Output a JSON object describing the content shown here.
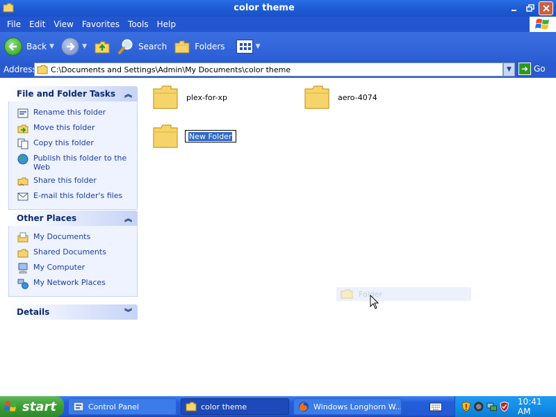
{
  "window": {
    "title": "color theme"
  },
  "menu": {
    "items": [
      "File",
      "Edit",
      "View",
      "Favorites",
      "Tools",
      "Help"
    ]
  },
  "toolbar": {
    "back_label": "Back",
    "search_label": "Search",
    "folders_label": "Folders"
  },
  "address": {
    "label": "Address",
    "path": "C:\\Documents and Settings\\Admin\\My Documents\\color theme",
    "go_label": "Go"
  },
  "tasks": {
    "title": "File and Folder Tasks",
    "items": [
      {
        "label": "Rename this folder",
        "icon": "rename-icon"
      },
      {
        "label": "Move this folder",
        "icon": "move-icon"
      },
      {
        "label": "Copy this folder",
        "icon": "copy-icon"
      },
      {
        "label": "Publish this folder to the Web",
        "icon": "globe-icon"
      },
      {
        "label": "Share this folder",
        "icon": "share-icon"
      },
      {
        "label": "E-mail this folder's files",
        "icon": "email-icon"
      }
    ]
  },
  "other_places": {
    "title": "Other Places",
    "items": [
      {
        "label": "My Documents",
        "icon": "my-documents-icon"
      },
      {
        "label": "Shared Documents",
        "icon": "folder-icon"
      },
      {
        "label": "My Computer",
        "icon": "computer-icon"
      },
      {
        "label": "My Network Places",
        "icon": "network-icon"
      }
    ]
  },
  "details": {
    "title": "Details"
  },
  "files": [
    {
      "name": "plex-for-xp"
    },
    {
      "name": "aero-4074"
    }
  ],
  "rename_edit": {
    "value": "New Folder"
  },
  "drag_ghost": {
    "label": "Folder"
  },
  "taskbar": {
    "start_label": "start",
    "items": [
      {
        "label": "Control Panel",
        "icon": "control-panel-icon"
      },
      {
        "label": "color theme",
        "icon": "folder-icon"
      },
      {
        "label": "Windows Longhorn W...",
        "icon": "firefox-icon"
      }
    ],
    "clock": "10:41 AM"
  },
  "colors": {
    "titlebar": "#1f5fd6",
    "taskpane_link": "#1c3aa6",
    "selection": "#316ac5",
    "start_green": "#3c9c35"
  }
}
